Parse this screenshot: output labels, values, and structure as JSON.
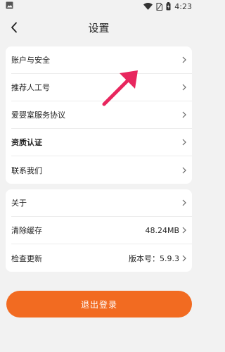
{
  "status_bar": {
    "time": "4:23",
    "icons": [
      "image-icon",
      "wifi-icon",
      "sim-icon",
      "battery-charging-icon"
    ]
  },
  "header": {
    "title": "设置",
    "back_icon": "back-chevron-icon"
  },
  "group1": [
    {
      "label": "账户与安全",
      "bold": false
    },
    {
      "label": "推荐人工号",
      "bold": false
    },
    {
      "label": "爱婴室服务协议",
      "bold": false
    },
    {
      "label": "资质认证",
      "bold": true
    },
    {
      "label": "联系我们",
      "bold": false
    }
  ],
  "group2": [
    {
      "label": "关于",
      "value": ""
    },
    {
      "label": "清除缓存",
      "value": "48.24MB"
    },
    {
      "label": "检查更新",
      "value": "版本号：5.9.3"
    }
  ],
  "logout_label": "退出登录",
  "colors": {
    "accent": "#f26b21",
    "annotation_arrow": "#e8265e",
    "background": "#f2f2f2"
  }
}
